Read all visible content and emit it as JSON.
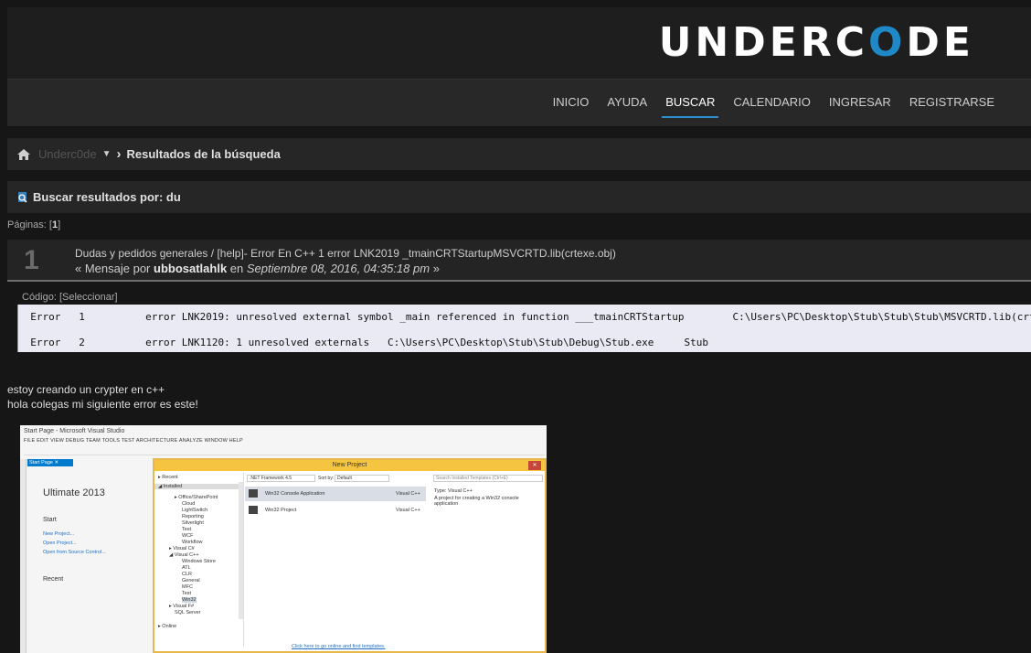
{
  "brand": {
    "logo_text_a": "UNDERC",
    "logo_text_o": "O",
    "logo_text_b": "DE"
  },
  "nav": {
    "items": [
      {
        "label": "INICIO"
      },
      {
        "label": "AYUDA"
      },
      {
        "label": "BUSCAR",
        "active": true
      },
      {
        "label": "CALENDARIO"
      },
      {
        "label": "INGRESAR"
      },
      {
        "label": "REGISTRARSE"
      }
    ]
  },
  "breadcrumb": {
    "forum": "Underc0de",
    "current": "Resultados de la búsqueda"
  },
  "search": {
    "title": "Buscar resultados por: du"
  },
  "pagination": {
    "label": "Páginas: ",
    "current": "1"
  },
  "result": {
    "number": "1",
    "board": "Dudas y pedidos generales",
    "separator": " / ",
    "topic": "[help]- Error En C++ 1 error LNK2019 _tmainCRTStartupMSVCRTD.lib(crtexe.obj)",
    "prefix": "« Mensaje por ",
    "author": "ubbosatlahlk",
    "in_word": " en ",
    "date": "Septiembre 08, 2016, 04:35:18 pm",
    "suffix": " »"
  },
  "code": {
    "label": "Código: [Seleccionar]",
    "lines": [
      "  Error   1          error LNK2019: unresolved external symbol _main referenced in function ___tmainCRTStartup        C:\\Users\\PC\\Desktop\\Stub\\Stub\\Stub\\MSVCRTD.lib(crtexe.obj)          Stub",
      "  Error   2          error LNK1120: 1 unresolved externals   C:\\Users\\PC\\Desktop\\Stub\\Stub\\Debug\\Stub.exe     Stub"
    ]
  },
  "message": {
    "line1": "estoy creando un crypter en c++",
    "line2": "hola colegas mi siguiente error es este!"
  },
  "vs_screenshot": {
    "title": "Start Page - Microsoft Visual Studio",
    "menus": "FILE   EDIT   VIEW   DEBUG   TEAM   TOOLS   TEST   ARCHITECTURE   ANALYZE   WINDOW   HELP",
    "tab": "Start Page  ✕",
    "ultimate": "Ultimate 2013",
    "start": "Start",
    "new_project": "New Project...",
    "open_project": "Open Project...",
    "open_source": "Open from Source Control...",
    "recent": "Recent",
    "dialog": {
      "title": "New Project",
      "framework": ".NET Framework 4.5",
      "sort_label": "Sort by:",
      "sort_value": "Default",
      "search_placeholder": "Search Installed Templates (Ctrl+E)",
      "tree": [
        "▸ Recent",
        "◢ Installed",
        "▸ Office/SharePoint",
        "Cloud",
        "LightSwitch",
        "Reporting",
        "Silverlight",
        "Test",
        "WCF",
        "Workflow",
        "▸ Visual C#",
        "◢ Visual C++",
        "Windows Store",
        "ATL",
        "CLR",
        "General",
        "MFC",
        "Test",
        "Win32",
        "▸ Visual F#",
        "SQL Server",
        "▸ Online"
      ],
      "templates": [
        {
          "name": "Win32 Console Application",
          "lang": "Visual C++"
        },
        {
          "name": "Win32 Project",
          "lang": "Visual C++"
        }
      ],
      "type_label": "Type:  Visual C++",
      "description": "A project for creating a Win32 console application",
      "online_link": "Click here to go online and find templates."
    }
  }
}
